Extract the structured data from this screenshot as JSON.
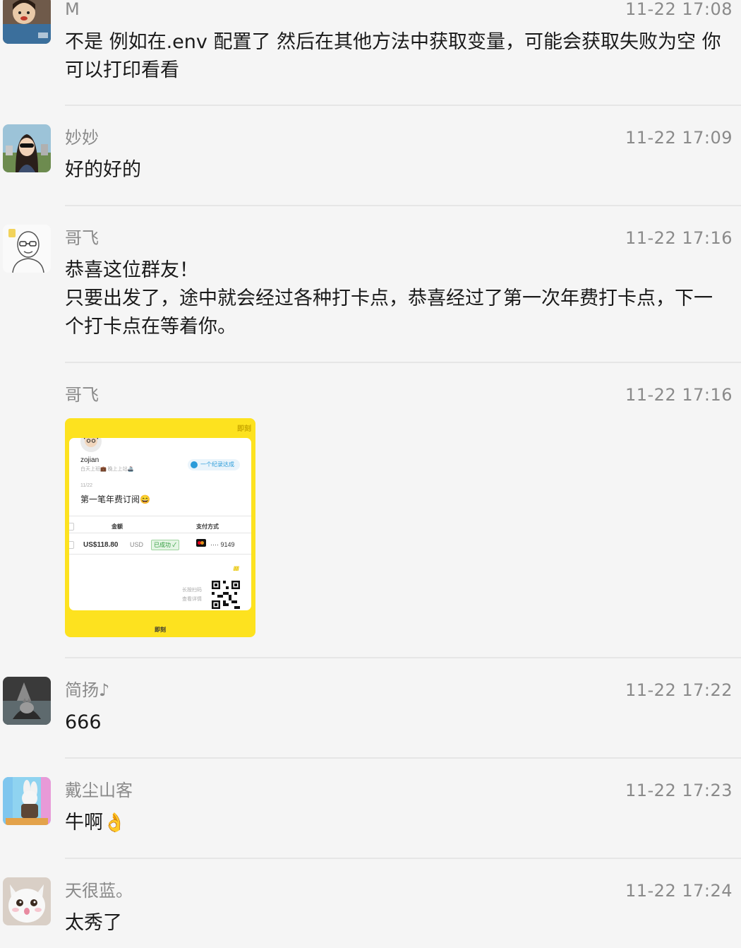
{
  "messages": [
    {
      "sender": "M",
      "time": "11-22 17:08",
      "lines": [
        "不是 例如在.env 配置了 然后在其他方法中获取变量，可能会获取失败为空 你",
        "可以打印看看"
      ]
    },
    {
      "sender": "妙妙",
      "time": "11-22 17:09",
      "lines": [
        "好的好的"
      ]
    },
    {
      "sender": "哥飞",
      "time": "11-22 17:16",
      "lines": [
        "恭喜这位群友！",
        "只要出发了，途中就会经过各种打卡点，恭喜经过了第一次年费打卡点，下一",
        "个打卡点在等着你。"
      ]
    },
    {
      "sender": "哥飞",
      "time": "11-22 17:16",
      "image_card": {
        "brand": "即刻",
        "username": "zojian",
        "status_text": "白天上班💼 晚上上站🚢",
        "pill": "一个纪录达成",
        "date": "11/22",
        "title": "第一笔年费订阅😄",
        "col_amount": "金额",
        "col_payment": "支付方式",
        "amount": "US$118.80",
        "currency": "USD",
        "status_badge": "已成功 ✓",
        "card_last4": "···· 9149",
        "stripes": "/////",
        "hint_line1": "长按扫码",
        "hint_line2": "查看详情"
      }
    },
    {
      "sender": "简扬♪",
      "time": "11-22 17:22",
      "lines": [
        "666"
      ]
    },
    {
      "sender": "戴尘山客",
      "time": "11-22 17:23",
      "lines": [
        "牛啊"
      ],
      "emoji": "👌"
    },
    {
      "sender": "天很蓝。",
      "time": "11-22 17:24",
      "lines": [
        "太秀了"
      ]
    }
  ],
  "colors": {
    "background": "#f5f5f5",
    "meta_text": "#8a8a8a",
    "card_yellow": "#fde21f"
  },
  "icons": [
    "avatar-m-icon",
    "avatar-miaomiao-icon",
    "avatar-gefei-icon",
    "avatar-jianyang-icon",
    "avatar-daichen-icon",
    "avatar-tianhenlan-icon",
    "mastercard-icon",
    "qr-code-icon"
  ]
}
